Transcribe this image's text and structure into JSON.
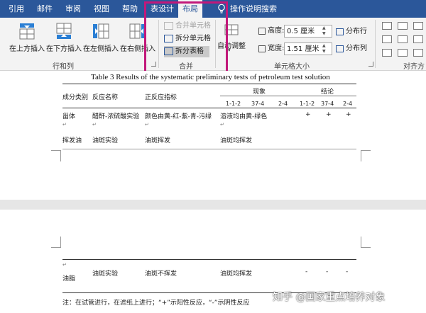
{
  "ribbon_tabs": [
    "引用",
    "邮件",
    "审阅",
    "视图",
    "帮助",
    "表设计",
    "布局",
    "操作说明搜索"
  ],
  "insert_buttons": [
    "在上方插入",
    "在下方插入",
    "在左侧插入",
    "在右侧插入"
  ],
  "groups": {
    "rows_cols": "行和列",
    "merge": "合并",
    "cell_size": "单元格大小",
    "alignment": "对齐方"
  },
  "merge": {
    "merge_cells": "合并单元格",
    "split_cells": "拆分单元格",
    "split_table": "拆分表格"
  },
  "autofit": "自动调整",
  "cell_size": {
    "height_label": "高度:",
    "height_value": "0.5 厘米",
    "width_label": "宽度:",
    "width_value": "1.51 厘米",
    "distribute_rows": "分布行",
    "distribute_cols": "分布列"
  },
  "document": {
    "caption": "Table 3 Results of the systematic preliminary tests of petroleum test solution",
    "headers": {
      "category": "成分类别",
      "reaction": "反应名称",
      "indicator": "正反应指标",
      "phenomenon": "现象",
      "conclusion": "结论",
      "sub_a": "1-1-2",
      "sub_b": "37-4",
      "sub_c": "2-4"
    },
    "row1": {
      "category": "甾体",
      "reaction": "醋酐-浓硫酸实验",
      "indicator": "颜色由黄-红-紫-青-污绿",
      "result": "溶液均由黄-绿色",
      "c1": "+",
      "c2": "+",
      "c3": "+"
    },
    "row2": {
      "category": "挥发油",
      "reaction": "油斑实验",
      "indicator": "油斑挥发",
      "result": "油斑均挥发"
    },
    "row3": {
      "category": "油脂",
      "reaction": "油斑实验",
      "indicator": "油斑不挥发",
      "result": "油斑均挥发",
      "c1": "-",
      "c2": "-",
      "c3": "-"
    },
    "footnote": "注：在试管进行，在滤纸上进行；“+”示阳性反应，“-”示阴性反应",
    "watermark": "知乎 @国家重点培养对象"
  }
}
